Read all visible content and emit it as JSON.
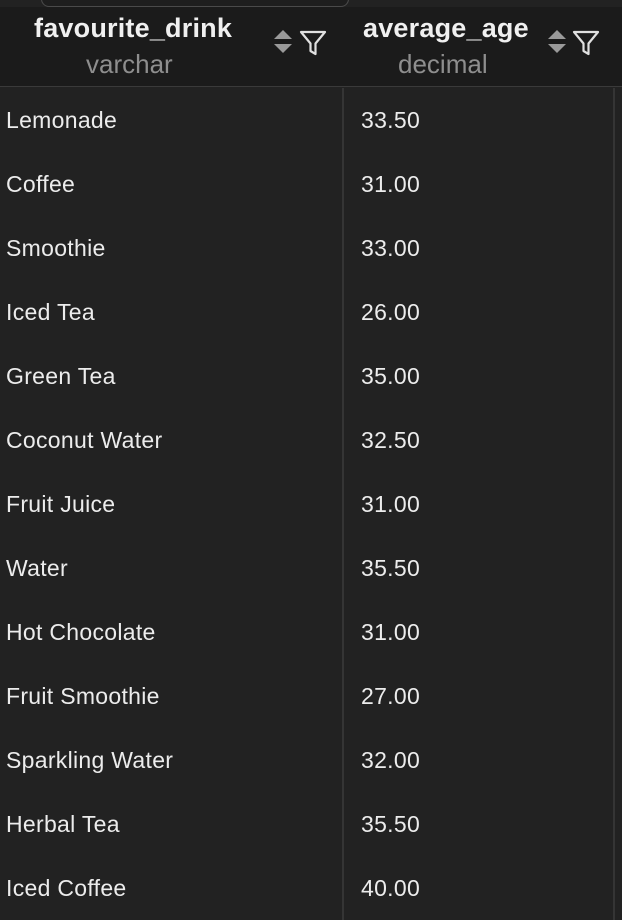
{
  "columns": [
    {
      "name": "favourite_drink",
      "type": "varchar"
    },
    {
      "name": "average_age",
      "type": "decimal"
    }
  ],
  "header_icons": [
    "sort-icon",
    "filter-icon"
  ],
  "rows": [
    {
      "favourite_drink": "Lemonade",
      "average_age": "33.50"
    },
    {
      "favourite_drink": "Coffee",
      "average_age": "31.00"
    },
    {
      "favourite_drink": "Smoothie",
      "average_age": "33.00"
    },
    {
      "favourite_drink": "Iced Tea",
      "average_age": "26.00"
    },
    {
      "favourite_drink": "Green Tea",
      "average_age": "35.00"
    },
    {
      "favourite_drink": "Coconut Water",
      "average_age": "32.50"
    },
    {
      "favourite_drink": "Fruit Juice",
      "average_age": "31.00"
    },
    {
      "favourite_drink": "Water",
      "average_age": "35.50"
    },
    {
      "favourite_drink": "Hot Chocolate",
      "average_age": "31.00"
    },
    {
      "favourite_drink": "Fruit Smoothie",
      "average_age": "27.00"
    },
    {
      "favourite_drink": "Sparkling Water",
      "average_age": "32.00"
    },
    {
      "favourite_drink": "Herbal Tea",
      "average_age": "35.50"
    },
    {
      "favourite_drink": "Iced Coffee",
      "average_age": "40.00"
    }
  ],
  "colors": {
    "background": "#222222",
    "header_background": "#1b1b1b",
    "text": "#ececec",
    "muted_text": "#8e8e8e",
    "grid_line": "#353535"
  }
}
